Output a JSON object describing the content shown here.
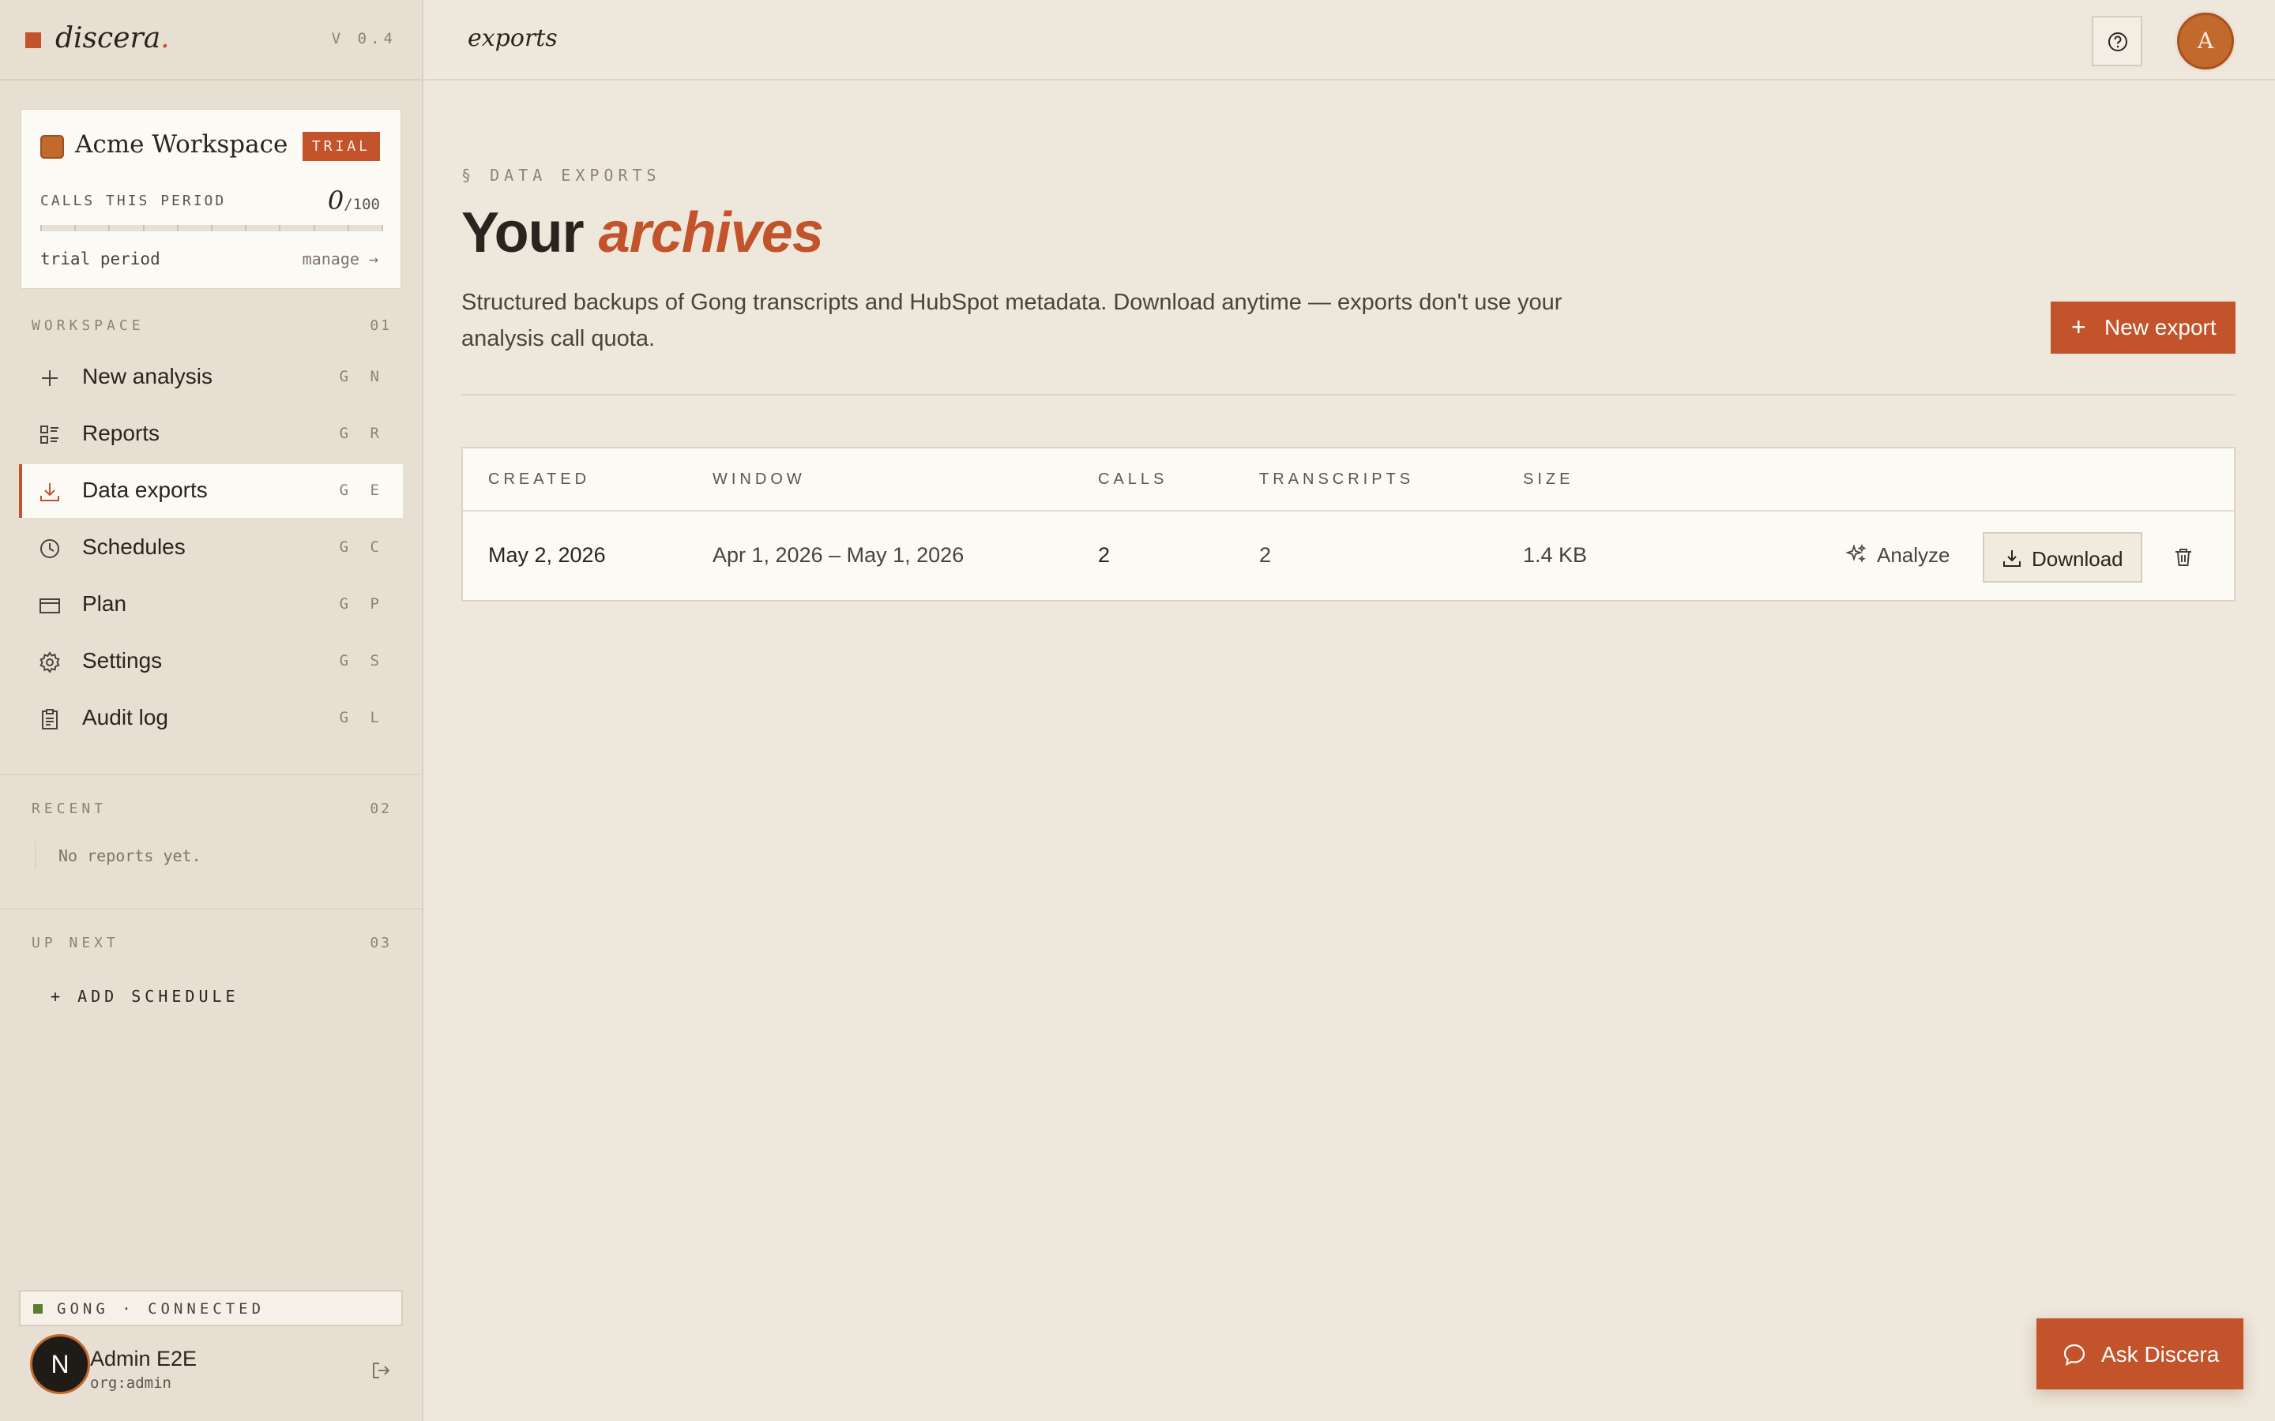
{
  "app": {
    "brand": "discera",
    "brand_dot": ".",
    "version": "V 0.4"
  },
  "workspace": {
    "name": "Acme Workspace",
    "badge": "TRIAL",
    "calls_label": "CALLS THIS PERIOD",
    "calls_used": "0",
    "calls_max": "/100",
    "calls_used_fraction": 0,
    "period_label": "trial period",
    "manage_label": "manage →"
  },
  "sidebar": {
    "workspace_section": {
      "title": "WORKSPACE",
      "num": "01"
    },
    "items": [
      {
        "label": "New analysis",
        "shortcut": "G N",
        "icon": "plus-icon"
      },
      {
        "label": "Reports",
        "shortcut": "G R",
        "icon": "reports-icon"
      },
      {
        "label": "Data exports",
        "shortcut": "G E",
        "icon": "download-icon",
        "active": true
      },
      {
        "label": "Schedules",
        "shortcut": "G C",
        "icon": "clock-icon"
      },
      {
        "label": "Plan",
        "shortcut": "G P",
        "icon": "card-icon"
      },
      {
        "label": "Settings",
        "shortcut": "G S",
        "icon": "gear-icon"
      },
      {
        "label": "Audit log",
        "shortcut": "G L",
        "icon": "clipboard-icon"
      }
    ],
    "recent_section": {
      "title": "RECENT",
      "num": "02",
      "empty": "No reports yet."
    },
    "upnext_section": {
      "title": "UP NEXT",
      "num": "03",
      "add": "+ ADD SCHEDULE"
    },
    "integration": {
      "status": "GONG · CONNECTED",
      "color": "#5a7d2f"
    },
    "user": {
      "initial": "N",
      "name": "Admin E2E",
      "org": "org:admin"
    }
  },
  "topbar": {
    "crumb": "exports",
    "avatar_initial": "A"
  },
  "main": {
    "eyebrow": "§ DATA EXPORTS",
    "title_plain": "Your ",
    "title_accent": "archives",
    "description": "Structured backups of Gong transcripts and HubSpot metadata. Download anytime — exports don't use your analysis call quota.",
    "new_export_label": "New export",
    "table": {
      "headers": [
        "CREATED",
        "WINDOW",
        "CALLS",
        "TRANSCRIPTS",
        "SIZE"
      ],
      "rows": [
        {
          "created": "May 2, 2026",
          "window": "Apr 1, 2026 – May 1, 2026",
          "calls": "2",
          "transcripts": "2",
          "size": "1.4 KB",
          "analyze_label": "Analyze",
          "download_label": "Download"
        }
      ]
    }
  },
  "ask_button": {
    "label": "Ask Discera"
  },
  "colors": {
    "accent": "#c2532b",
    "background": "#eee7db",
    "sidebar": "#e7dfd1",
    "connected": "#5a7d2f"
  }
}
